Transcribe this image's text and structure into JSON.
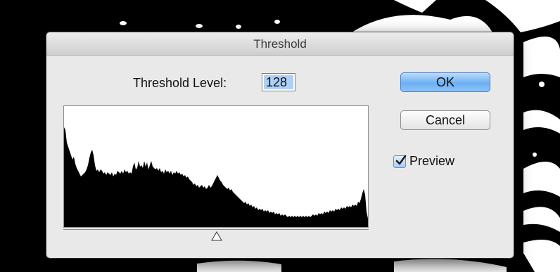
{
  "dialog": {
    "title": "Threshold",
    "threshold_label": "Threshold Level:",
    "threshold_value": "128",
    "buttons": {
      "ok": "OK",
      "cancel": "Cancel"
    },
    "preview": {
      "label": "Preview",
      "checked": true
    }
  },
  "histogram": {
    "slider_value": 128,
    "slider_max": 255
  },
  "colors": {
    "accent": "#6cb0f4",
    "input_selection": "#aed0f6",
    "histogram_fill": "#000000"
  }
}
